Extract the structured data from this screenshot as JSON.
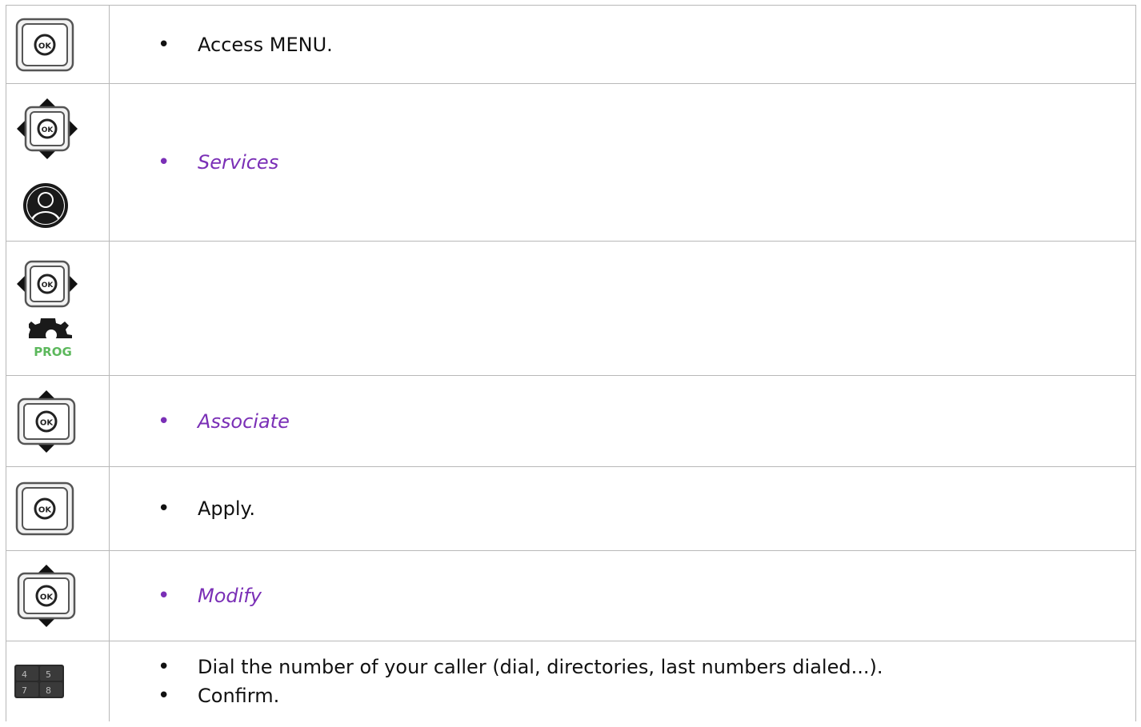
{
  "colors": {
    "ui_label": "#7a2fb6",
    "prog_green": "#5cb85c",
    "key_dark": "#1a1a1a",
    "border": "#b8b8b8"
  },
  "icons": {
    "ok_key": "ok-key-icon",
    "nav_4way": "navigator-four-way-icon",
    "nav_lr": "navigator-left-right-icon",
    "nav_ud": "navigator-up-down-icon",
    "user": "user-profile-icon",
    "prog": "prog-gear-icon",
    "keypad": "keypad-icon"
  },
  "ok_text": "OK",
  "prog_text": "PROG",
  "keypad_digits": [
    "4",
    "5",
    "7",
    "8"
  ],
  "rows": [
    {
      "items": [
        "Access MENU."
      ]
    },
    {
      "items": [
        "Services"
      ]
    },
    {
      "items": []
    },
    {
      "items": [
        "Associate"
      ]
    },
    {
      "items": [
        "Apply."
      ]
    },
    {
      "items": [
        "Modify"
      ]
    },
    {
      "items": [
        "Dial the number of your caller (dial, directories, last numbers dialed...).",
        "Confirm."
      ]
    }
  ]
}
